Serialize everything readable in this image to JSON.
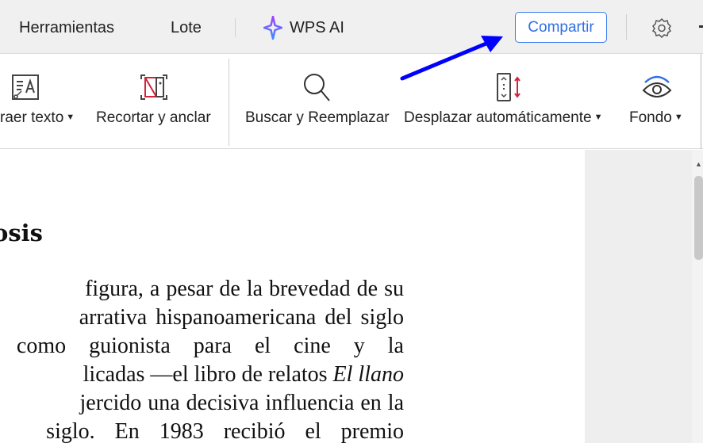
{
  "topbar": {
    "tabs": [
      "Herramientas",
      "Lote"
    ],
    "ai_label": "WPS AI",
    "share_label": "Compartir"
  },
  "toolbar": {
    "items": [
      {
        "label": "raer texto",
        "icon": "extract-text-icon",
        "dropdown": true
      },
      {
        "label": "Recortar y anclar",
        "icon": "crop-anchor-icon",
        "dropdown": false
      },
      {
        "label": "Buscar y Reemplazar",
        "icon": "search-icon",
        "dropdown": false
      },
      {
        "label": "Desplazar automáticamente",
        "icon": "auto-scroll-icon",
        "dropdown": true
      },
      {
        "label": "Fondo",
        "icon": "eye-icon",
        "dropdown": true
      }
    ]
  },
  "document": {
    "heading": "osis",
    "lines": [
      "figura, a pesar de la brevedad de su",
      "arrativa hispanoamericana del siglo",
      "como guionista para el cine y la",
      "licadas —el libro de relatos ",
      "jercido una decisiva influencia en la",
      "siglo. En 1983 recibió el premio"
    ],
    "italic": "El llano"
  },
  "colors": {
    "accent": "#2f6fe6",
    "annotation_arrow": "#0000ff"
  }
}
